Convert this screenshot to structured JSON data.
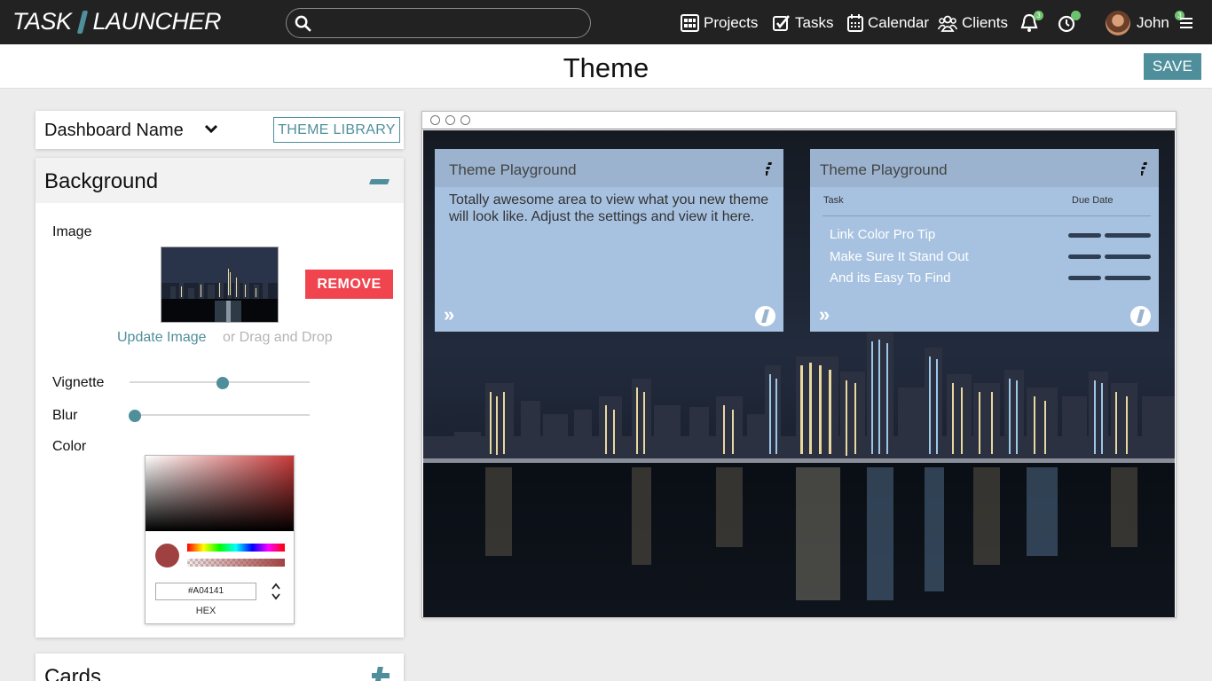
{
  "app": {
    "logo_left": "TASK",
    "logo_right": "LAUNCHER"
  },
  "search": {
    "placeholder": "",
    "value": ""
  },
  "nav": {
    "projects": "Projects",
    "tasks": "Tasks",
    "calendar": "Calendar",
    "clients": "Clients",
    "notifications_count": "3",
    "user_name": "John",
    "menu_count": "3"
  },
  "page": {
    "title": "Theme",
    "save_label": "SAVE"
  },
  "dashboard": {
    "name": "Dashboard Name",
    "theme_library_label": "THEME LIBRARY"
  },
  "background": {
    "title": "Background",
    "image_label": "Image",
    "remove_label": "REMOVE",
    "update_link": "Update Image",
    "drag_text": "or Drag and Drop",
    "vignette_label": "Vignette",
    "vignette_value": 0.5,
    "blur_label": "Blur",
    "blur_value": 0,
    "color_label": "Color",
    "color": {
      "hex": "#A04141",
      "hex_label": "HEX"
    }
  },
  "cards_section": {
    "title": "Cards"
  },
  "preview": {
    "card1": {
      "title": "Theme Playground",
      "body": "Totally awesome area to view what you new theme will look like. Adjust the settings and view it here."
    },
    "card2": {
      "title": "Theme Playground",
      "col_task": "Task",
      "col_due": "Due Date",
      "rows": [
        {
          "name": "Link Color Pro Tip"
        },
        {
          "name": "Make Sure It Stand Out"
        },
        {
          "name": "And its Easy To Find"
        }
      ]
    }
  },
  "colors": {
    "accent": "#4f8f9b",
    "danger": "#f0454f",
    "nav_bg": "#222222",
    "card_bg": "#a7c2e0"
  }
}
